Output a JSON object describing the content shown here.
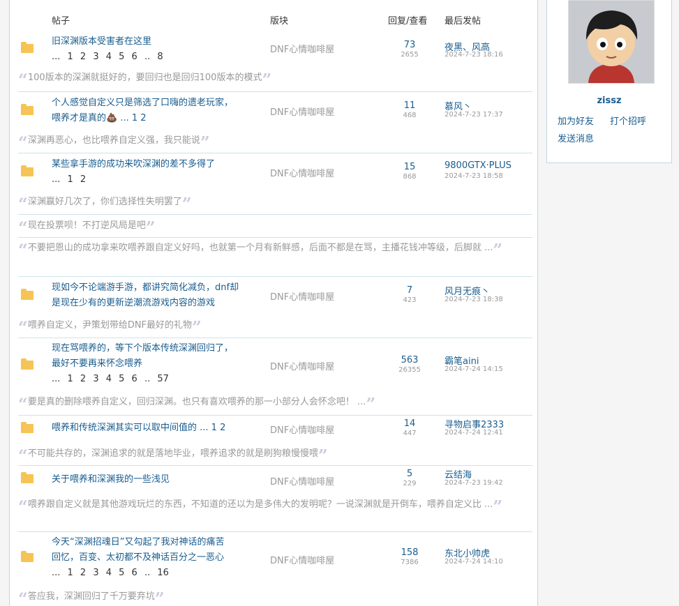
{
  "header": {
    "col_post": "帖子",
    "col_forum": "版块",
    "col_replies_views": "回复/查看",
    "col_last_post": "最后发帖"
  },
  "threads": [
    {
      "line1": "旧深渊版本受害者在这里",
      "line2": "",
      "pages": "... 1 2 3 4 5 6 .. 8",
      "forum": "DNF心情咖啡屋",
      "replies": "73",
      "views": "2655",
      "last_user": "夜黑、风高",
      "last_time": "2024-7-23 18:16",
      "quotes": [
        "100版本的深渊就挺好的，要回归也是回归100版本的模式"
      ]
    },
    {
      "line1": "个人感觉自定义只是筛选了口嗨的遗老玩家，",
      "line2": "喂养才是真的💩 ... 1 2",
      "pages": "",
      "forum": "DNF心情咖啡屋",
      "replies": "11",
      "views": "468",
      "last_user": "慕风丶",
      "last_time": "2024-7-23 17:37",
      "quotes": [
        "深渊再恶心，也比喂养自定义强，我只能说"
      ]
    },
    {
      "line1": "某些拿手游的成功来吹深渊的差不多得了",
      "line2": "",
      "pages": "... 1 2",
      "forum": "DNF心情咖啡屋",
      "replies": "15",
      "views": "868",
      "last_user": "9800GTX·PLUS",
      "last_time": "2024-7-23 18:58",
      "quotes": [
        "深渊赢好几次了，你们选择性失明罢了",
        "现在投票呗！不打逆风局是吧",
        "不要把恩山的成功拿来吹喂养跟自定义好吗，也就第一个月有新鲜感，后面不都是在骂，主播花钱冲等级，后脚就 ..."
      ]
    },
    {
      "line1": "现如今不论端游手游，都讲究简化减负，dnf却",
      "line2": "是现在少有的更新逆潮流游戏内容的游戏",
      "pages": "",
      "forum": "DNF心情咖啡屋",
      "replies": "7",
      "views": "423",
      "last_user": "风月无痕丶",
      "last_time": "2024-7-23 18:38",
      "quotes": [
        "喂养自定义，尹策划带给DNF最好的礼物"
      ]
    },
    {
      "line1": "现在骂喂养的，等下个版本传统深渊回归了，",
      "line2": "最好不要再来怀念喂养",
      "pages": "... 1 2 3 4 5 6 .. 57",
      "forum": "DNF心情咖啡屋",
      "replies": "563",
      "views": "26355",
      "last_user": "霸笔aini",
      "last_time": "2024-7-24 14:15",
      "quotes": [
        "要是真的删除喂养自定义，回归深渊。也只有喜欢喂养的那一小部分人会怀念吧！ ..."
      ]
    },
    {
      "line1": "喂养和传统深渊其实可以取中间值的 ... 1 2",
      "line2": "",
      "pages": "",
      "forum": "DNF心情咖啡屋",
      "replies": "14",
      "views": "447",
      "last_user": "寻物启事2333",
      "last_time": "2024-7-24 12:41",
      "quotes": [
        "不可能共存的，深渊追求的就是落地毕业，喂养追求的就是刷狗粮慢慢喂"
      ]
    },
    {
      "line1": "关于喂养和深渊我的一些浅见",
      "line2": "",
      "pages": "",
      "forum": "DNF心情咖啡屋",
      "replies": "5",
      "views": "229",
      "last_user": "云结海",
      "last_time": "2024-7-23 19:42",
      "quotes": [
        "喂养跟自定义就是其他游戏玩烂的东西，不知道的还以为是多伟大的发明呢？一说深渊就是开倒车，喂养自定义比 ..."
      ]
    },
    {
      "line1": "今天“深渊招魂日”又勾起了我对神话的痛苦",
      "line2": "回忆，百变、太初都不及神话百分之一恶心",
      "pages": "... 1 2 3 4 5 6 .. 16",
      "forum": "DNF心情咖啡屋",
      "replies": "158",
      "views": "7386",
      "last_user": "东北小帅虎",
      "last_time": "2024-7-24 14:10",
      "quotes": [
        "答应我，深渊回归了千万要弃坑"
      ]
    }
  ],
  "sidebar": {
    "username": "zissz",
    "add_friend": "加为好友",
    "say_hi": "打个招呼",
    "send_message": "发送消息"
  }
}
